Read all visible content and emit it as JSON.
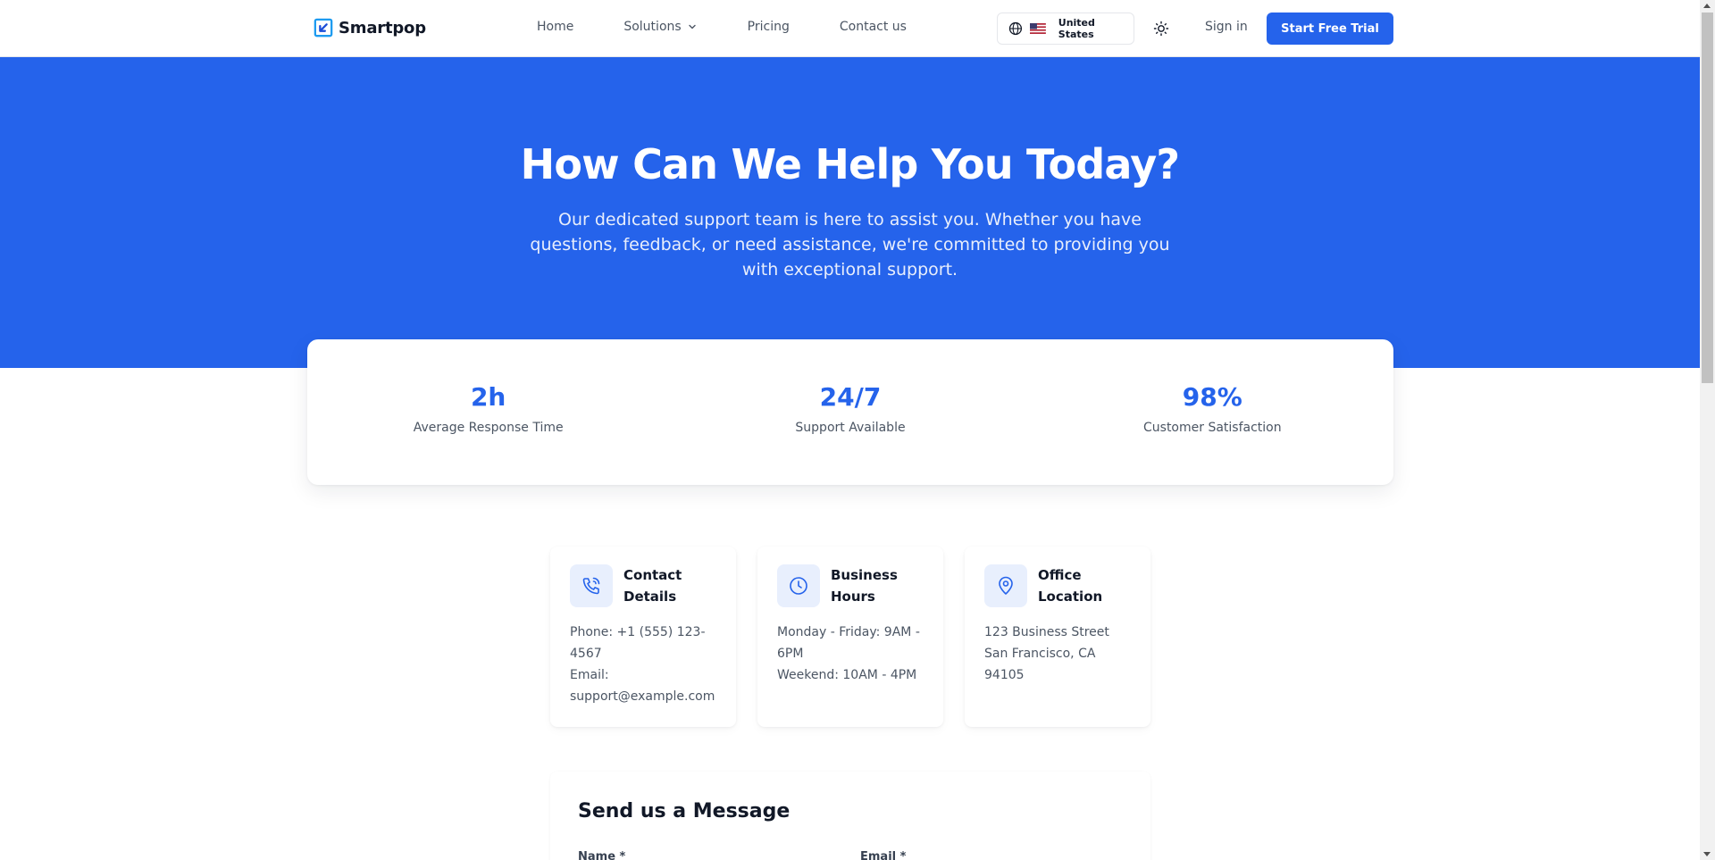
{
  "brand": {
    "name": "Smartpop",
    "accent": "#2563eb"
  },
  "nav": {
    "home": "Home",
    "solutions": "Solutions",
    "pricing": "Pricing",
    "contact": "Contact us"
  },
  "header": {
    "country": "United States",
    "signin": "Sign in",
    "cta": "Start Free Trial"
  },
  "hero": {
    "title": "How Can We Help You Today?",
    "subtitle": "Our dedicated support team is here to assist you. Whether you have questions, feedback, or need assistance, we're committed to providing you with exceptional support."
  },
  "stats": [
    {
      "value": "2h",
      "label": "Average Response Time"
    },
    {
      "value": "24/7",
      "label": "Support Available"
    },
    {
      "value": "98%",
      "label": "Customer Satisfaction"
    }
  ],
  "cards": {
    "contact": {
      "icon": "phone-icon",
      "title": "Contact Details",
      "line1": "Phone: +1 (555) 123-4567",
      "line2": "Email: support@example.com"
    },
    "hours": {
      "icon": "clock-icon",
      "title": "Business Hours",
      "line1": "Monday - Friday: 9AM - 6PM",
      "line2": "Weekend: 10AM - 4PM"
    },
    "office": {
      "icon": "map-pin-icon",
      "title": "Office Location",
      "line1": "123 Business Street",
      "line2": "San Francisco, CA 94105"
    }
  },
  "form": {
    "title": "Send us a Message",
    "name_label": "Name *",
    "email_label": "Email *"
  }
}
